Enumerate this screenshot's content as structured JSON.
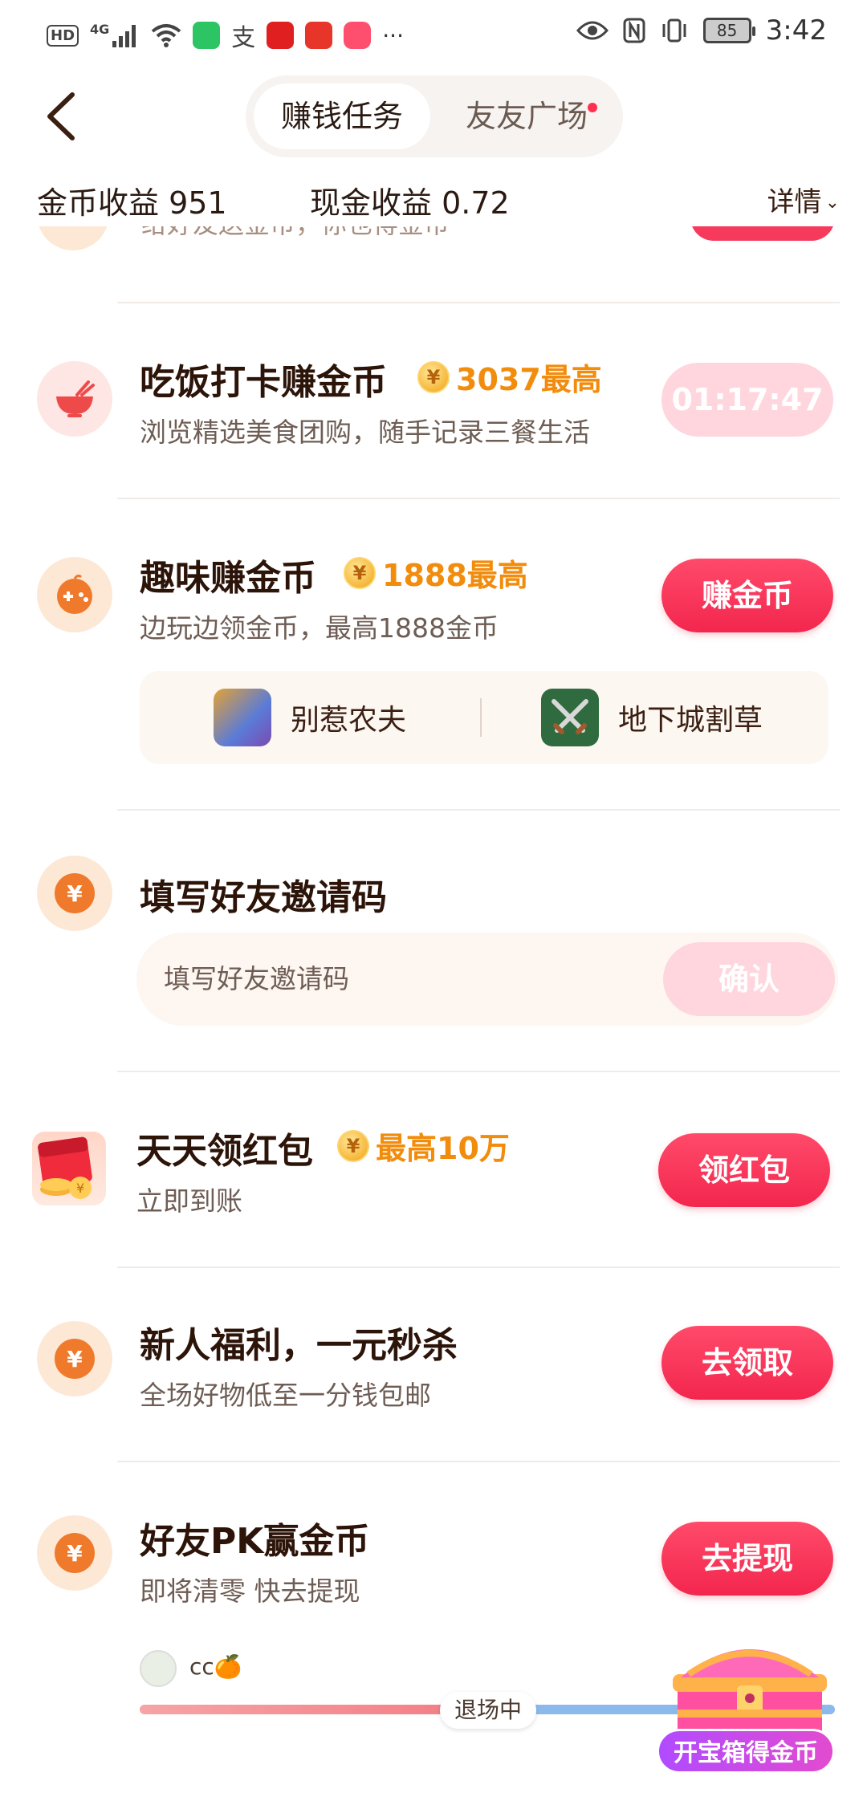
{
  "status_bar": {
    "hd": "HD",
    "network": "4G",
    "time": "3:42",
    "battery": "85",
    "more": "···"
  },
  "header": {
    "tabs": [
      {
        "label": "赚钱任务",
        "active": true
      },
      {
        "label": "友友广场",
        "active": false
      }
    ]
  },
  "earnings": {
    "coin": "金币收益 951",
    "cash": "现金收益 0.72",
    "detail": "详情"
  },
  "partial_row": {
    "desc": "给好友送金币，你也得金币"
  },
  "tasks": {
    "meal": {
      "title": "吃饭打卡赚金币",
      "reward": "3037最高",
      "desc": "浏览精选美食团购，随手记录三餐生活",
      "button": "01:17:47"
    },
    "fun": {
      "title": "趣味赚金币",
      "reward": "1888最高",
      "desc": "边玩边领金币，最高1888金币",
      "button": "赚金币",
      "games": [
        {
          "name": "别惹农夫"
        },
        {
          "name": "地下城割草"
        }
      ]
    },
    "invite": {
      "title": "填写好友邀请码",
      "placeholder": "填写好友邀请码",
      "button": "确认"
    },
    "redpacket": {
      "title": "天天领红包",
      "reward": "最高10万",
      "desc": "立即到账",
      "button": "领红包"
    },
    "newuser": {
      "title": "新人福利，一元秒杀",
      "desc": "全场好物低至一分钱包邮",
      "button": "去领取"
    },
    "pk": {
      "title": "好友PK赢金币",
      "desc": "即将清零 快去提现",
      "button": "去提现",
      "friend_name": "cc🍊",
      "status": "退场中"
    }
  },
  "treasure": {
    "label": "开宝箱得金币"
  },
  "colors": {
    "accent": "#f3264e",
    "reward": "#f28c0c",
    "icon_bg": "#fde8d6",
    "icon_fg": "#f07a2c"
  }
}
